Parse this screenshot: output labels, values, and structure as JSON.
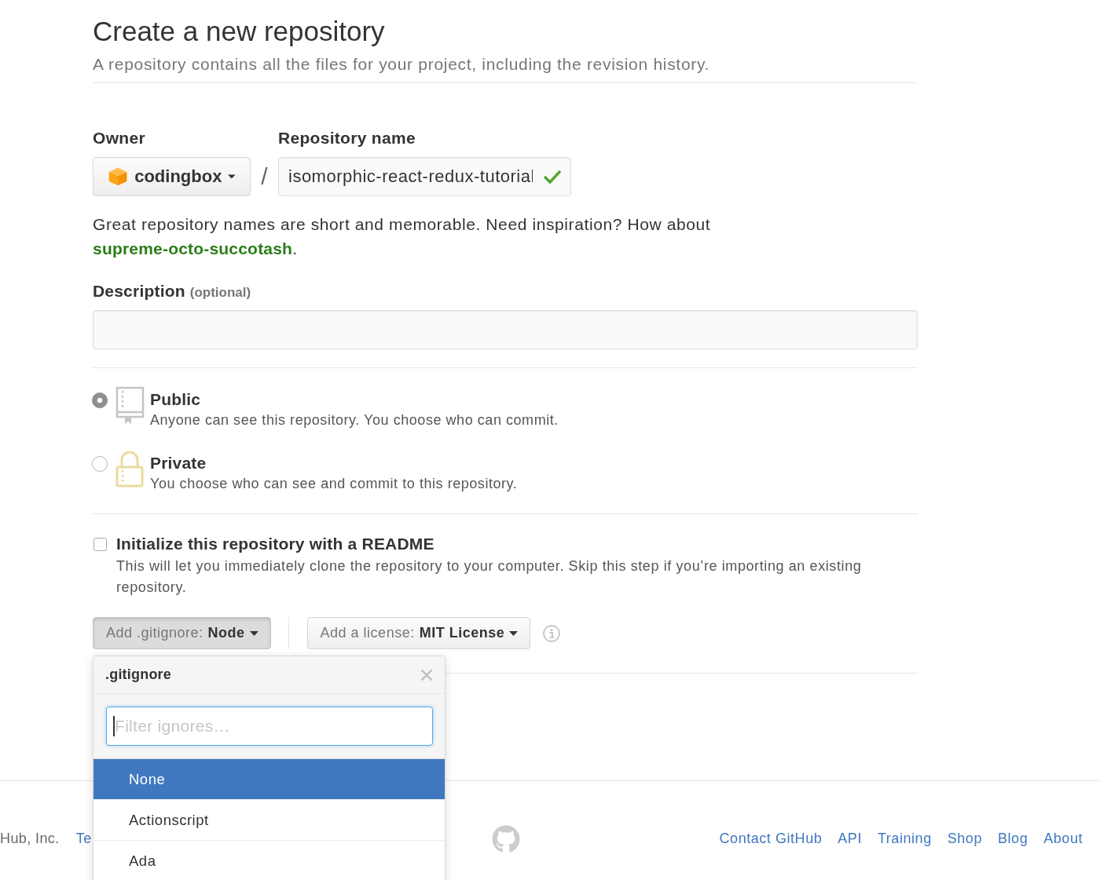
{
  "header": {
    "title": "Create a new repository",
    "subtitle": "A repository contains all the files for your project, including the revision history."
  },
  "owner": {
    "label": "Owner",
    "value": "codingbox"
  },
  "separator": "/",
  "repository_name": {
    "label": "Repository name",
    "value": "isomorphic-react-redux-tutorial",
    "valid": true
  },
  "name_hint": {
    "text": "Great repository names are short and memorable. Need inspiration? How about",
    "suggestion": "supreme-octo-succotash",
    "end": "."
  },
  "description": {
    "label": "Description",
    "note": "(optional)"
  },
  "visibility": [
    {
      "kind": "public",
      "title": "Public",
      "text": "Anyone can see this repository. You choose who can commit.",
      "selected": true
    },
    {
      "kind": "private",
      "title": "Private",
      "text": "You choose who can see and commit to this repository.",
      "selected": false
    }
  ],
  "readme": {
    "label": "Initialize this repository with a README",
    "text": "This will let you immediately clone the repository to your computer. Skip this step if you’re importing an existing repository.",
    "checked": false
  },
  "gitignore_button": {
    "label": "Add .gitignore:",
    "value": "Node",
    "pressed": true
  },
  "license_button": {
    "label": "Add a license:",
    "value": "MIT License",
    "pressed": false
  },
  "gitignore_menu": {
    "title": ".gitignore",
    "filter": {
      "placeholder": "Filter ignores…",
      "focused": true
    },
    "items": [
      {
        "label": "None",
        "selected": true
      },
      {
        "label": "Actionscript",
        "selected": false
      },
      {
        "label": "Ada",
        "selected": false
      }
    ]
  },
  "footer": {
    "left": [
      {
        "kind": "text",
        "text": "Hub, Inc."
      },
      {
        "kind": "link",
        "text": "Te"
      }
    ],
    "links": [
      "Contact GitHub",
      "API",
      "Training",
      "Shop",
      "Blog",
      "About"
    ]
  }
}
